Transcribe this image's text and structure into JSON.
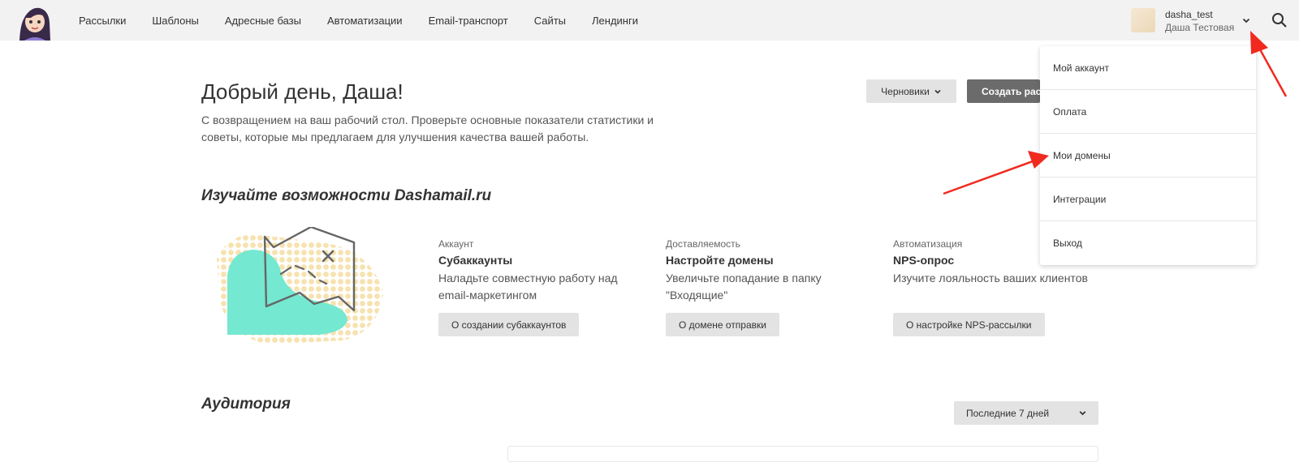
{
  "nav": {
    "items": [
      "Рассылки",
      "Шаблоны",
      "Адресные базы",
      "Автоматизации",
      "Email-транспорт",
      "Сайты",
      "Лендинги"
    ]
  },
  "user": {
    "login": "dasha_test",
    "name": "Даша Тестовая"
  },
  "user_menu": {
    "items": [
      "Мой аккаунт",
      "Оплата",
      "Мои домены",
      "Интеграции",
      "Выход"
    ]
  },
  "greeting": {
    "title": "Добрый день, Даша!",
    "text": "С возвращением на ваш рабочий стол. Проверьте основные показатели статистики и советы, которые мы предлагаем для улучшения качества вашей работы."
  },
  "actions": {
    "drafts_label": "Черновики",
    "create_label": "Создать рассылку"
  },
  "features": {
    "title": "Изучайте возможности Dashamail.ru",
    "cards": [
      {
        "category": "Аккаунт",
        "title": "Субаккаунты",
        "description": "Наладьте совместную работу над email-маркетингом",
        "button": "О создании субаккаунтов"
      },
      {
        "category": "Доставляемость",
        "title": "Настройте домены",
        "description": "Увеличьте попадание в папку \"Входящие\"",
        "button": "О домене отправки"
      },
      {
        "category": "Автоматизация",
        "title": "NPS-опрос",
        "description": "Изучите лояльность ваших клиентов",
        "button": "О настройке NPS-рассылки"
      }
    ]
  },
  "audience": {
    "title": "Аудитория",
    "period": "Последние 7 дней"
  },
  "colors": {
    "topbar": "#f2f2f2",
    "accent_mint": "#74e8d0",
    "dots": "#f7e2b0",
    "annotation_arrow": "#f02a1f"
  }
}
